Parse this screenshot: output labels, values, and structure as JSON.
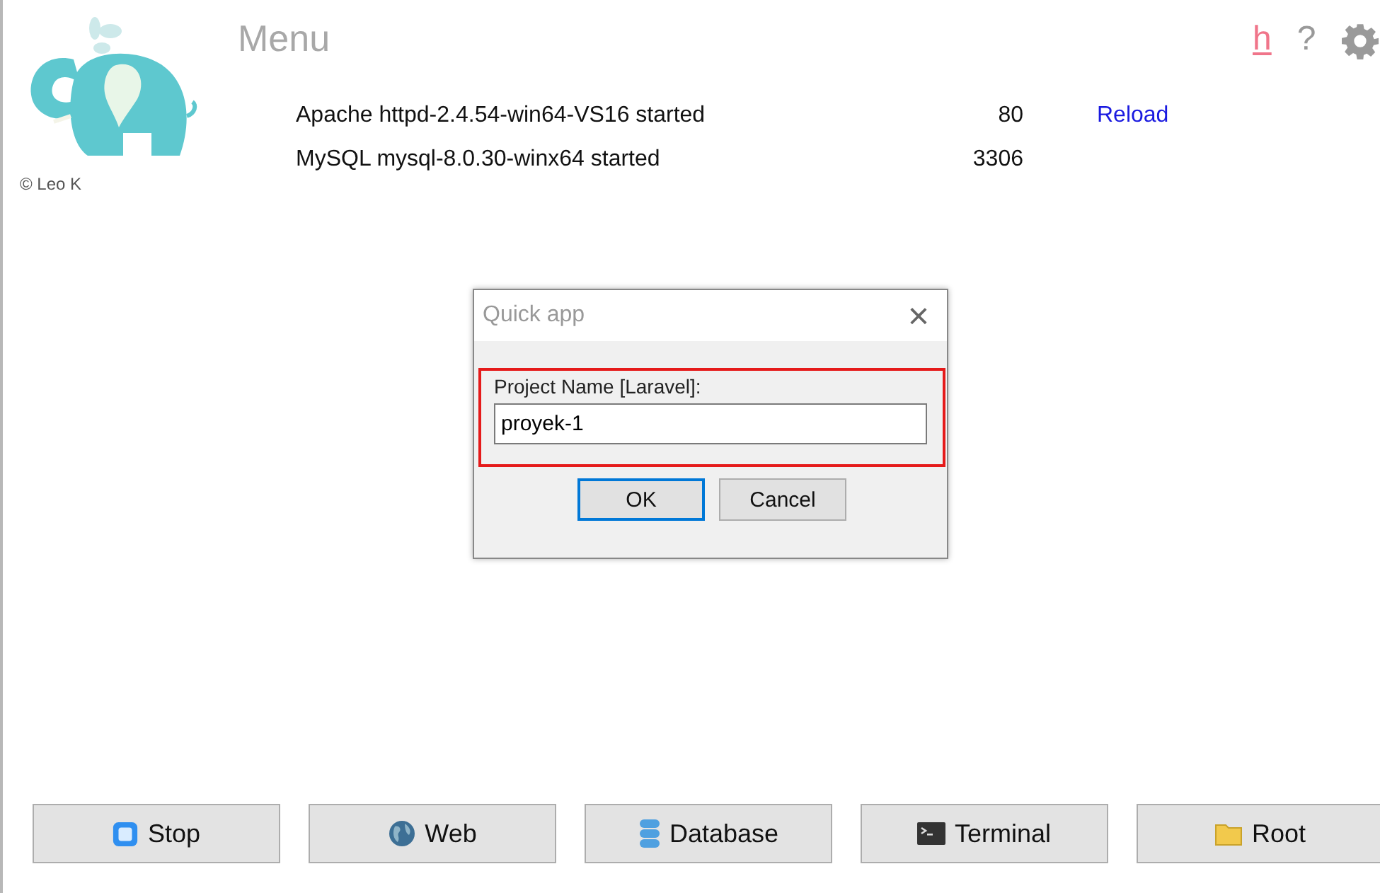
{
  "header": {
    "credit": "© Leo K",
    "title": "Menu",
    "help_link": "h",
    "help_mark": "?"
  },
  "services": [
    {
      "name": "Apache httpd-2.4.54-win64-VS16 started",
      "port": "80",
      "action": "Reload"
    },
    {
      "name": "MySQL mysql-8.0.30-winx64 started",
      "port": "3306"
    }
  ],
  "dialog": {
    "title": "Quick app",
    "close": "×",
    "field_label": "Project Name [Laravel]:",
    "value": "proyek-1",
    "highlighted": true,
    "buttons": [
      {
        "label": "OK",
        "focused": true
      },
      {
        "label": "Cancel",
        "focused": false
      }
    ]
  },
  "buttons": [
    {
      "label": "Stop",
      "kind": "stop"
    },
    {
      "label": "Web",
      "kind": "web"
    },
    {
      "label": "Database",
      "kind": "database"
    },
    {
      "label": "Terminal",
      "kind": "terminal"
    },
    {
      "label": "Root",
      "kind": "folder"
    }
  ]
}
